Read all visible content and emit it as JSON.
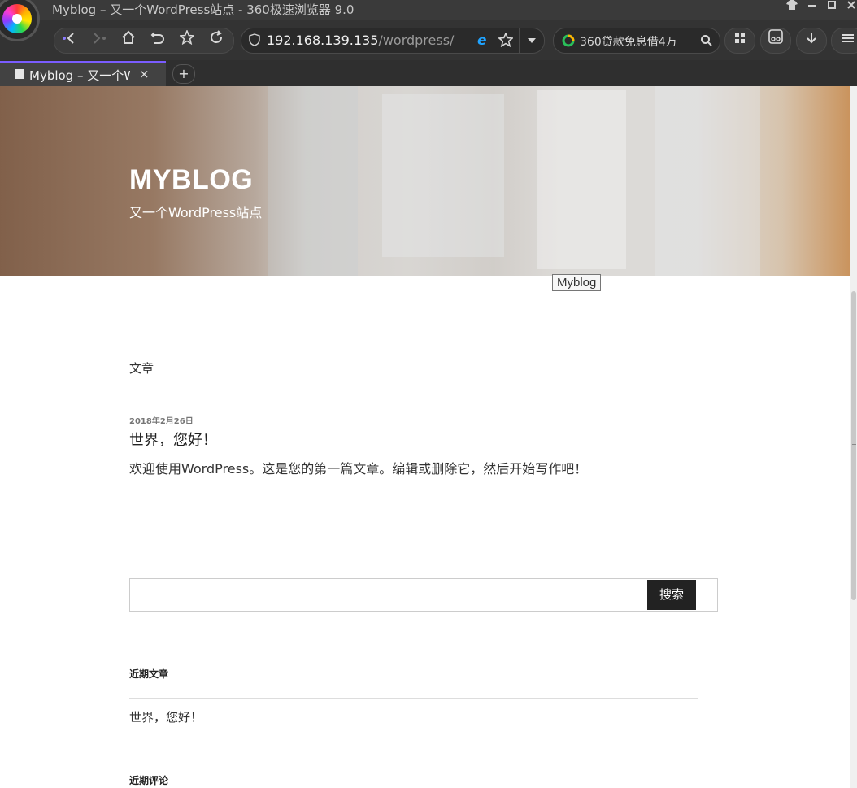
{
  "browser": {
    "window_title": "Myblog – 又一个WordPress站点 - 360极速浏览器 9.0",
    "address": {
      "host": "192.168.139.135",
      "path": "/wordpress/"
    },
    "search_box_text": "360贷款免息借4万",
    "tabs": [
      {
        "label": "Myblog – 又一个W",
        "close": "×"
      }
    ],
    "new_tab_label": "+"
  },
  "site": {
    "title": "MYBLOG",
    "description": "又一个WordPress站点",
    "tooltip": "Myblog"
  },
  "main": {
    "section_label": "文章",
    "post": {
      "date": "2018年2月26日",
      "title": "世界，您好！",
      "excerpt": "欢迎使用WordPress。这是您的第一篇文章。编辑或删除它，然后开始写作吧！"
    }
  },
  "sidebar": {
    "search_button": "搜索",
    "search_value": "",
    "recent_posts_title": "近期文章",
    "recent_posts": [
      "世界，您好！"
    ],
    "recent_comments_title": "近期评论"
  }
}
